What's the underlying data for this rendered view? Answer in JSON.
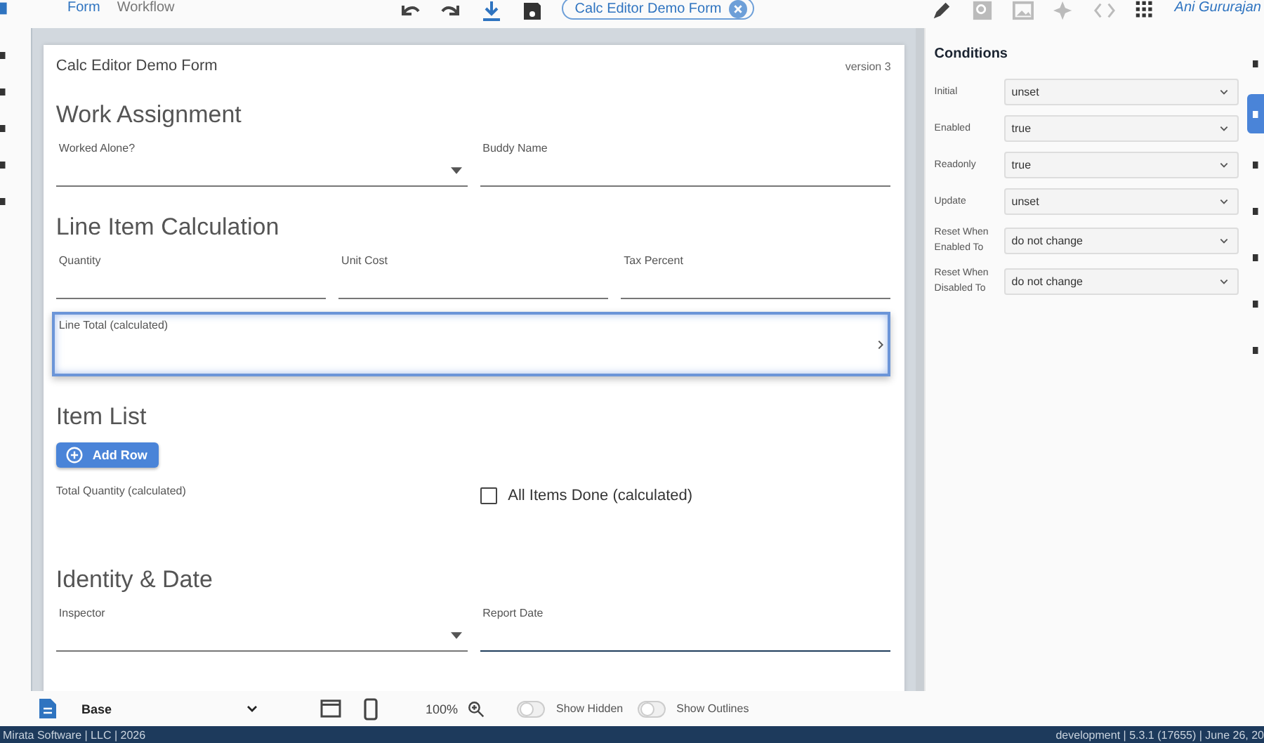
{
  "top_bar": {
    "tabs": [
      {
        "label": "Form",
        "selected": true
      },
      {
        "label": "Workflow",
        "selected": false
      }
    ],
    "form_chip": "Calc Editor Demo Form",
    "user": "Ani Gururajan"
  },
  "form": {
    "title": "Calc Editor Demo Form",
    "version": "version 3",
    "sections": [
      {
        "heading": "Work Assignment",
        "rows": [
          [
            {
              "kind": "dropdown",
              "label": "Worked Alone?",
              "selected": false
            },
            {
              "kind": "text",
              "label": "Buddy Name",
              "selected": false
            }
          ]
        ]
      },
      {
        "heading": "Line Item Calculation",
        "rows": [
          [
            {
              "kind": "text",
              "label": "Quantity",
              "selected": false
            },
            {
              "kind": "text",
              "label": "Unit Cost",
              "selected": false
            },
            {
              "kind": "text",
              "label": "Tax Percent",
              "selected": false
            }
          ],
          [
            {
              "kind": "calculated",
              "label": "Line Total (calculated)",
              "selected": true
            }
          ]
        ]
      },
      {
        "heading": "Item List",
        "rows": [
          [
            {
              "kind": "button",
              "label": "Add Row",
              "selected": false
            }
          ],
          [
            {
              "kind": "calculated",
              "label": "Total Quantity (calculated)",
              "selected": false
            },
            {
              "kind": "checkbox",
              "label": "All Items Done (calculated)",
              "checked": false,
              "selected": false
            }
          ]
        ]
      },
      {
        "heading": "Identity & Date",
        "rows": [
          [
            {
              "kind": "dropdown",
              "label": "Inspector",
              "selected": false
            },
            {
              "kind": "date",
              "label": "Report Date",
              "selected": false
            }
          ]
        ]
      }
    ]
  },
  "conditions": {
    "title": "Conditions",
    "rows": [
      {
        "label": "Initial",
        "value": "unset"
      },
      {
        "label": "Enabled",
        "value": "true"
      },
      {
        "label": "Readonly",
        "value": "true"
      },
      {
        "label": "Update",
        "value": "unset"
      },
      {
        "label": "Reset When Enabled To",
        "value": "do not change"
      },
      {
        "label": "Reset When Disabled To",
        "value": "do not change"
      }
    ]
  },
  "right_rail": [
    {
      "selected": false
    },
    {
      "selected": true
    },
    {
      "selected": false
    },
    {
      "selected": false
    },
    {
      "selected": false
    },
    {
      "selected": false
    },
    {
      "selected": false
    }
  ],
  "bottom_toolbar": {
    "layout": "Base",
    "zoom": "100%",
    "toggles": [
      {
        "label": "Show Hidden",
        "on": false
      },
      {
        "label": "Show Outlines",
        "on": false
      }
    ]
  },
  "footer": {
    "left": "Mirata Software | LLC | 2026",
    "right": "development | 5.3.1 (17655) | June 26, 20"
  }
}
